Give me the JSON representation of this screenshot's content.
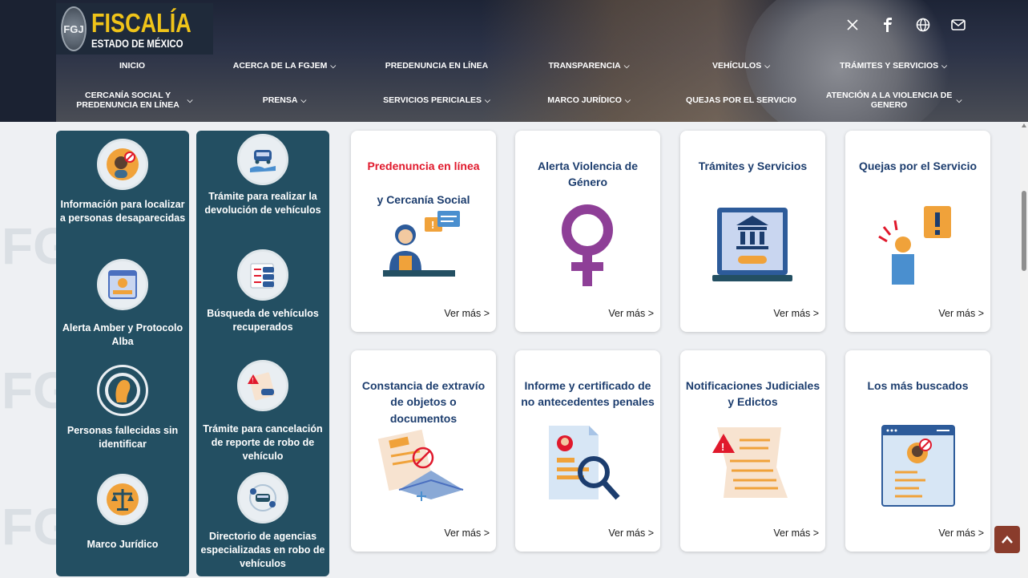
{
  "header": {
    "logo_seal": "FGJ",
    "logo_title": "FISCALÍA",
    "logo_subtitle": "ESTADO DE MÉXICO",
    "social_icons": [
      "x-icon",
      "facebook-icon",
      "globe-icon",
      "mail-icon"
    ]
  },
  "nav": {
    "row1": [
      {
        "label": "INICIO",
        "dropdown": false
      },
      {
        "label": "ACERCA DE LA FGJEM",
        "dropdown": true
      },
      {
        "label": "PREDENUNCIA EN LÍNEA",
        "dropdown": false
      },
      {
        "label": "TRANSPARENCIA",
        "dropdown": true
      },
      {
        "label": "VEHÍCULOS",
        "dropdown": true
      },
      {
        "label": "TRÁMITES Y SERVICIOS",
        "dropdown": true
      }
    ],
    "row2": [
      {
        "label": "CERCANÍA SOCIAL Y PREDENUNCIA EN LÍNEA",
        "dropdown": true
      },
      {
        "label": "PRENSA",
        "dropdown": true
      },
      {
        "label": "SERVICIOS PERICIALES",
        "dropdown": true
      },
      {
        "label": "MARCO JURÍDICO",
        "dropdown": true
      },
      {
        "label": "QUEJAS POR EL SERVICIO",
        "dropdown": false
      },
      {
        "label": "ATENCIÓN A LA VIOLENCIA DE GENERO",
        "dropdown": true
      }
    ],
    "chevron": "⌄"
  },
  "left_panel_1": [
    {
      "label": "Información para localizar a personas desaparecidas",
      "icon": "missing-person-icon"
    },
    {
      "label": "Alerta Amber y Protocolo Alba",
      "icon": "amber-alert-icon"
    },
    {
      "label": "Personas fallecidas sin identificar",
      "icon": "unidentified-person-icon"
    },
    {
      "label": "Marco Jurídico",
      "icon": "scales-icon"
    }
  ],
  "left_panel_2": [
    {
      "label": "Trámite para realizar la devolución de vehículos",
      "icon": "vehicle-return-icon"
    },
    {
      "label": "Búsqueda de vehículos recuperados",
      "icon": "vehicle-search-icon"
    },
    {
      "label": "Trámite para cancelación de reporte de robo de vehículo",
      "icon": "theft-report-icon"
    },
    {
      "label": "Directorio de agencias especializadas en robo de vehículos",
      "icon": "agency-directory-icon"
    }
  ],
  "cards_row1": [
    {
      "title": "Predenuncia en línea",
      "subtitle": "y Cercanía Social",
      "more": "Ver más >",
      "icon": "online-complaint-icon"
    },
    {
      "title": "Alerta Violencia de Género",
      "more": "Ver más >",
      "icon": "female-symbol-icon"
    },
    {
      "title": "Trámites y Servicios",
      "more": "Ver más >",
      "icon": "laptop-bank-icon"
    },
    {
      "title": "Quejas por el Servicio",
      "more": "Ver más >",
      "icon": "complaint-alert-icon"
    }
  ],
  "cards_row2": [
    {
      "title": "Constancia de extravío de objetos o documentos",
      "more": "Ver más >",
      "icon": "lost-documents-icon"
    },
    {
      "title": "Informe y certificado de no antecedentes penales",
      "more": "Ver más >",
      "icon": "certificate-search-icon"
    },
    {
      "title": "Notificaciones Judiciales y Edictos",
      "more": "Ver más >",
      "icon": "notification-document-icon"
    },
    {
      "title": "Los más buscados",
      "more": "Ver más >",
      "icon": "most-wanted-icon"
    }
  ],
  "scroll_top_label": "^",
  "colors": {
    "panel": "#234f62",
    "title_blue": "#1c3d6e",
    "title_red": "#e0192c",
    "logo_yellow": "#f0c419",
    "scroll_top": "#8a3c2c"
  }
}
